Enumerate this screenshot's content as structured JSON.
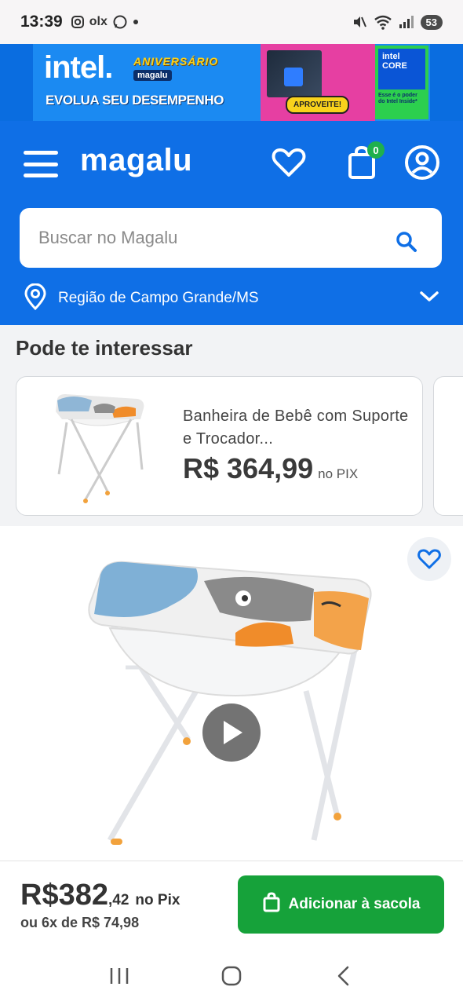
{
  "status_bar": {
    "time": "13:39",
    "olx_label": "olx",
    "battery": "53"
  },
  "ad": {
    "brand": "intel.",
    "anniversary": "ANIVERSÁRIO",
    "magalu_tag": "magalu",
    "tagline": "EVOLUA SEU DESEMPENHO",
    "cta": "APROVEITE!",
    "core_line1": "intel",
    "core_line2": "CORE",
    "core_sub": "Esse é o poder do Intel Inside*"
  },
  "header": {
    "logo": "magalu",
    "bag_count": "0",
    "search_placeholder": "Buscar no Magalu",
    "region": "Região de Campo Grande/MS"
  },
  "recommendations": {
    "title": "Pode te interessar",
    "items": [
      {
        "title": "Banheira de Bebê com Suporte e Trocador...",
        "price": "R$ 364,99",
        "price_note": "no PIX"
      }
    ]
  },
  "product": {
    "price_int": "R$382",
    "price_cents": ",42",
    "price_note": "no Pix",
    "installments": "ou 6x de R$ 74,98",
    "add_button": "Adicionar à sacola"
  },
  "colors": {
    "header_blue": "#0f6fe6",
    "add_green": "#16a23a",
    "badge_green": "#1fb04d"
  }
}
